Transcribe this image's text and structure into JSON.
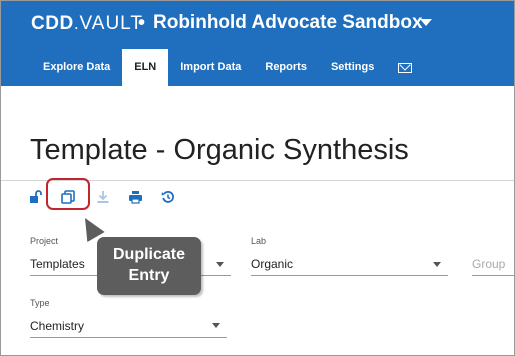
{
  "header": {
    "brand_cdd": "CDD",
    "brand_vault": "VAULT",
    "separator": "•",
    "project": "Robinhold Advocate Sandbox"
  },
  "nav": {
    "tabs": [
      {
        "label": "Explore Data"
      },
      {
        "label": "ELN"
      },
      {
        "label": "Import Data"
      },
      {
        "label": "Reports"
      },
      {
        "label": "Settings"
      }
    ]
  },
  "page": {
    "title": "Template - Organic Synthesis"
  },
  "callout": {
    "line1": "Duplicate",
    "line2": "Entry"
  },
  "fields": {
    "project": {
      "label": "Project",
      "value": "Templates"
    },
    "lab": {
      "label": "Lab",
      "value": "Organic"
    },
    "group": {
      "placeholder": "Group"
    },
    "type": {
      "label": "Type",
      "value": "Chemistry"
    }
  },
  "colors": {
    "brand_blue": "#1f6fbe",
    "highlight_red": "#c0262c",
    "callout_gray": "#5d5d5d"
  }
}
